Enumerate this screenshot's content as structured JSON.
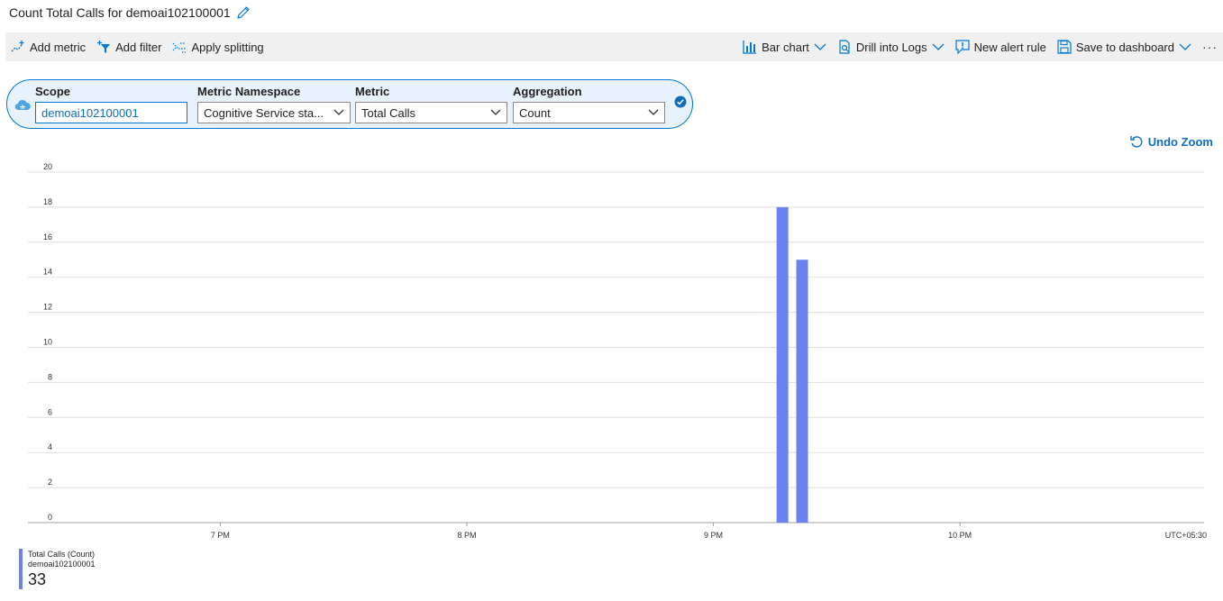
{
  "title": {
    "text": "Count Total Calls for demoai102100001",
    "edit_icon": "pencil-icon"
  },
  "toolbar": {
    "add_metric": "Add metric",
    "add_filter": "Add filter",
    "apply_splitting": "Apply splitting",
    "bar_chart": "Bar chart",
    "drill_into_logs": "Drill into Logs",
    "new_alert_rule": "New alert rule",
    "save_to_dashboard": "Save to dashboard",
    "more": "···"
  },
  "query": {
    "scope_label": "Scope",
    "scope_value": "demoai102100001",
    "namespace_label": "Metric Namespace",
    "namespace_value": "Cognitive Service sta...",
    "metric_label": "Metric",
    "metric_value": "Total Calls",
    "aggregation_label": "Aggregation",
    "aggregation_value": "Count"
  },
  "undo_zoom": "Undo Zoom",
  "chart_data": {
    "type": "bar",
    "y_ticks": [
      "0",
      "2",
      "4",
      "6",
      "8",
      "10",
      "12",
      "14",
      "16",
      "18",
      "20"
    ],
    "ylim": [
      0,
      20
    ],
    "x_ticks": [
      "7 PM",
      "8 PM",
      "9 PM",
      "10 PM"
    ],
    "x_hours": [
      19,
      20,
      21,
      22
    ],
    "xlim": [
      18.22,
      22.99
    ],
    "timezone": "UTC+05:30",
    "bar_color": "#6b81ee",
    "grid": true,
    "series": [
      {
        "name": "Total Calls (Count)",
        "x": [
          21.28,
          21.36
        ],
        "values": [
          18,
          15
        ]
      }
    ]
  },
  "legend": {
    "series_name": "Total Calls (Count)",
    "resource": "demoai102100001",
    "total": "33",
    "color": "#6b81ee"
  }
}
